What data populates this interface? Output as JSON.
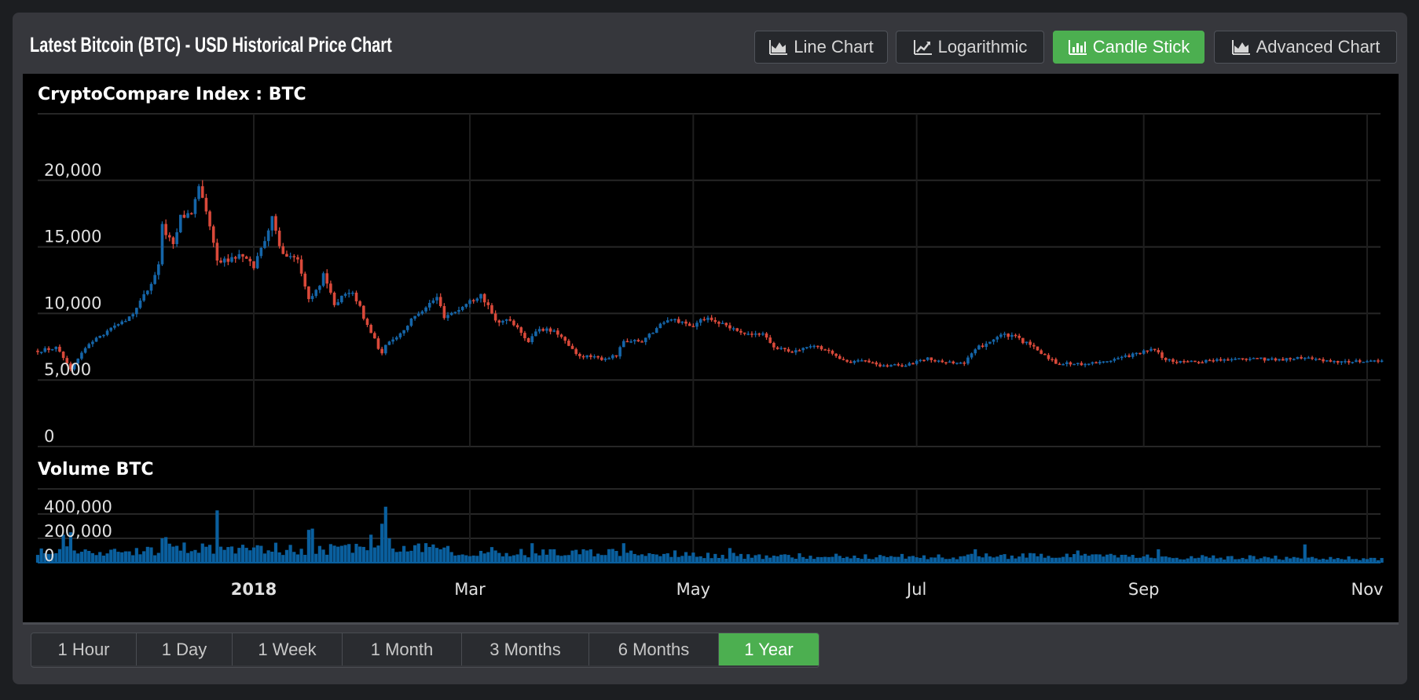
{
  "header": {
    "title": "Latest Bitcoin (BTC) - USD Historical Price Chart",
    "chart_types": [
      {
        "label": "Line Chart",
        "icon": "area-chart-icon",
        "active": false
      },
      {
        "label": "Logarithmic",
        "icon": "line-chart-icon",
        "active": false
      },
      {
        "label": "Candle Stick",
        "icon": "bar-chart-icon",
        "active": true
      },
      {
        "label": "Advanced Chart",
        "icon": "area-chart-icon",
        "active": false
      }
    ]
  },
  "ranges": [
    {
      "label": "1 Hour",
      "active": false
    },
    {
      "label": "1 Day",
      "active": false
    },
    {
      "label": "1 Week",
      "active": false
    },
    {
      "label": "1 Month",
      "active": false
    },
    {
      "label": "3 Months",
      "active": false
    },
    {
      "label": "6 Months",
      "active": false
    },
    {
      "label": "1 Year",
      "active": true
    }
  ],
  "colors": {
    "up": "#1565a8",
    "down": "#d9493a",
    "volume": "#0a5f9e",
    "active": "#4caf50"
  },
  "chart_data": [
    {
      "type": "candlestick",
      "title": "CryptoCompare Index : BTC",
      "ylim": [
        0,
        25000
      ],
      "yticks": [
        0,
        5000,
        10000,
        15000,
        20000
      ],
      "ytick_labels": [
        "0",
        "5,000",
        "10,000",
        "15,000",
        "20,000"
      ],
      "x_range": [
        "2017-11-03",
        "2018-11-05"
      ],
      "xticks": [
        {
          "date": "2018-01-01",
          "label": "2018",
          "bold": true
        },
        {
          "date": "2018-03-01",
          "label": "Mar"
        },
        {
          "date": "2018-05-01",
          "label": "May"
        },
        {
          "date": "2018-07-01",
          "label": "Jul"
        },
        {
          "date": "2018-09-01",
          "label": "Sep"
        },
        {
          "date": "2018-11-01",
          "label": "Nov"
        }
      ],
      "grid": true,
      "close_keypoints": [
        [
          "2017-11-03",
          7200
        ],
        [
          "2017-11-08",
          7400
        ],
        [
          "2017-11-12",
          5900
        ],
        [
          "2017-11-17",
          7800
        ],
        [
          "2017-11-26",
          9300
        ],
        [
          "2017-11-29",
          9900
        ],
        [
          "2017-12-01",
          10800
        ],
        [
          "2017-12-06",
          13500
        ],
        [
          "2017-12-07",
          16500
        ],
        [
          "2017-12-10",
          15000
        ],
        [
          "2017-12-12",
          17200
        ],
        [
          "2017-12-15",
          17600
        ],
        [
          "2017-12-17",
          19300
        ],
        [
          "2017-12-20",
          16500
        ],
        [
          "2017-12-22",
          13800
        ],
        [
          "2017-12-25",
          14000
        ],
        [
          "2017-12-28",
          14400
        ],
        [
          "2018-01-01",
          13500
        ],
        [
          "2018-01-06",
          17100
        ],
        [
          "2018-01-08",
          15000
        ],
        [
          "2018-01-10",
          14400
        ],
        [
          "2018-01-13",
          14200
        ],
        [
          "2018-01-16",
          11200
        ],
        [
          "2018-01-17",
          11200
        ],
        [
          "2018-01-20",
          12800
        ],
        [
          "2018-01-23",
          10800
        ],
        [
          "2018-01-28",
          11700
        ],
        [
          "2018-02-01",
          9100
        ],
        [
          "2018-02-05",
          6900
        ],
        [
          "2018-02-06",
          7700
        ],
        [
          "2018-02-10",
          8500
        ],
        [
          "2018-02-15",
          10100
        ],
        [
          "2018-02-20",
          11200
        ],
        [
          "2018-02-22",
          9800
        ],
        [
          "2018-02-26",
          10300
        ],
        [
          "2018-03-04",
          11500
        ],
        [
          "2018-03-08",
          9400
        ],
        [
          "2018-03-12",
          9500
        ],
        [
          "2018-03-17",
          7900
        ],
        [
          "2018-03-20",
          8900
        ],
        [
          "2018-03-25",
          8500
        ],
        [
          "2018-03-30",
          6900
        ],
        [
          "2018-04-01",
          6800
        ],
        [
          "2018-04-06",
          6600
        ],
        [
          "2018-04-10",
          6800
        ],
        [
          "2018-04-12",
          7900
        ],
        [
          "2018-04-17",
          7900
        ],
        [
          "2018-04-21",
          8900
        ],
        [
          "2018-04-24",
          9600
        ],
        [
          "2018-05-01",
          9100
        ],
        [
          "2018-05-05",
          9800
        ],
        [
          "2018-05-10",
          9000
        ],
        [
          "2018-05-15",
          8500
        ],
        [
          "2018-05-20",
          8500
        ],
        [
          "2018-05-23",
          7500
        ],
        [
          "2018-05-28",
          7100
        ],
        [
          "2018-06-03",
          7700
        ],
        [
          "2018-06-10",
          6700
        ],
        [
          "2018-06-13",
          6300
        ],
        [
          "2018-06-17",
          6500
        ],
        [
          "2018-06-22",
          6000
        ],
        [
          "2018-06-24",
          6100
        ],
        [
          "2018-06-29",
          6200
        ],
        [
          "2018-07-04",
          6600
        ],
        [
          "2018-07-10",
          6300
        ],
        [
          "2018-07-14",
          6250
        ],
        [
          "2018-07-17",
          7300
        ],
        [
          "2018-07-24",
          8400
        ],
        [
          "2018-07-28",
          8200
        ],
        [
          "2018-08-01",
          7600
        ],
        [
          "2018-08-08",
          6300
        ],
        [
          "2018-08-14",
          6200
        ],
        [
          "2018-08-20",
          6300
        ],
        [
          "2018-08-26",
          6700
        ],
        [
          "2018-09-04",
          7300
        ],
        [
          "2018-09-07",
          6500
        ],
        [
          "2018-09-12",
          6300
        ],
        [
          "2018-09-20",
          6500
        ],
        [
          "2018-09-28",
          6600
        ],
        [
          "2018-10-10",
          6550
        ],
        [
          "2018-10-15",
          6700
        ],
        [
          "2018-10-20",
          6450
        ],
        [
          "2018-11-01",
          6350
        ],
        [
          "2018-11-05",
          6400
        ]
      ]
    },
    {
      "type": "bar",
      "title": "Volume BTC",
      "ylim": [
        0,
        560000
      ],
      "yticks": [
        0,
        200000,
        400000
      ],
      "ytick_labels": [
        "0",
        "200,000",
        "400,000"
      ],
      "volume_keypoints": [
        [
          "2017-11-03",
          110000
        ],
        [
          "2017-11-15",
          90000
        ],
        [
          "2017-12-01",
          100000
        ],
        [
          "2017-12-20",
          130000
        ],
        [
          "2018-01-15",
          110000
        ],
        [
          "2018-02-10",
          120000
        ],
        [
          "2018-03-15",
          80000
        ],
        [
          "2018-04-15",
          80000
        ],
        [
          "2018-05-15",
          55000
        ],
        [
          "2018-07-01",
          50000
        ],
        [
          "2018-08-01",
          55000
        ],
        [
          "2018-09-15",
          45000
        ],
        [
          "2018-11-05",
          35000
        ]
      ],
      "volume_spikes": [
        [
          "2017-11-10",
          230000
        ],
        [
          "2017-11-12",
          250000
        ],
        [
          "2017-12-07",
          200000
        ],
        [
          "2017-12-08",
          210000
        ],
        [
          "2017-12-22",
          430000
        ],
        [
          "2018-01-16",
          270000
        ],
        [
          "2018-01-17",
          280000
        ],
        [
          "2018-02-02",
          230000
        ],
        [
          "2018-02-05",
          320000
        ],
        [
          "2018-02-06",
          460000
        ],
        [
          "2018-02-07",
          200000
        ],
        [
          "2018-03-18",
          160000
        ],
        [
          "2018-04-12",
          160000
        ],
        [
          "2018-05-11",
          120000
        ],
        [
          "2018-07-17",
          110000
        ],
        [
          "2018-08-14",
          100000
        ],
        [
          "2018-09-05",
          110000
        ],
        [
          "2018-10-15",
          150000
        ]
      ]
    }
  ]
}
